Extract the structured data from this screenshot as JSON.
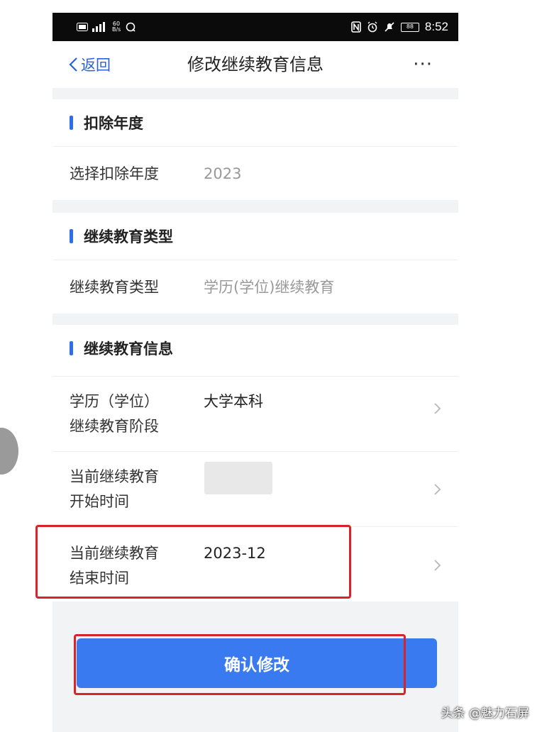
{
  "status_bar": {
    "network_top": "60",
    "network_bottom": "B/s",
    "time": "8:52",
    "battery": "88"
  },
  "nav": {
    "back_label": "返回",
    "title": "修改继续教育信息",
    "more_label": "···"
  },
  "sections": {
    "deduction_year": {
      "title": "扣除年度",
      "row_label": "选择扣除年度",
      "row_value": "2023"
    },
    "education_type": {
      "title": "继续教育类型",
      "row_label": "继续教育类型",
      "row_value": "学历(学位)继续教育"
    },
    "education_info": {
      "title": "继续教育信息",
      "rows": [
        {
          "label_line1": "学历（学位）",
          "label_line2": "继续教育阶段",
          "value": "大学本科"
        },
        {
          "label_line1": "当前继续教育",
          "label_line2": "开始时间",
          "value": ""
        },
        {
          "label_line1": "当前继续教育",
          "label_line2": "结束时间",
          "value": "2023-12"
        }
      ]
    }
  },
  "confirm_button": "确认修改",
  "watermark": "头条 @魅力石屏",
  "colors": {
    "accent": "#2f6fe6",
    "button": "#3a7af0",
    "highlight": "#d6242a",
    "status_bar": "#0b0b0b"
  },
  "icons": [
    "back-chevron-icon",
    "more-icon",
    "chevron-right-icon"
  ]
}
